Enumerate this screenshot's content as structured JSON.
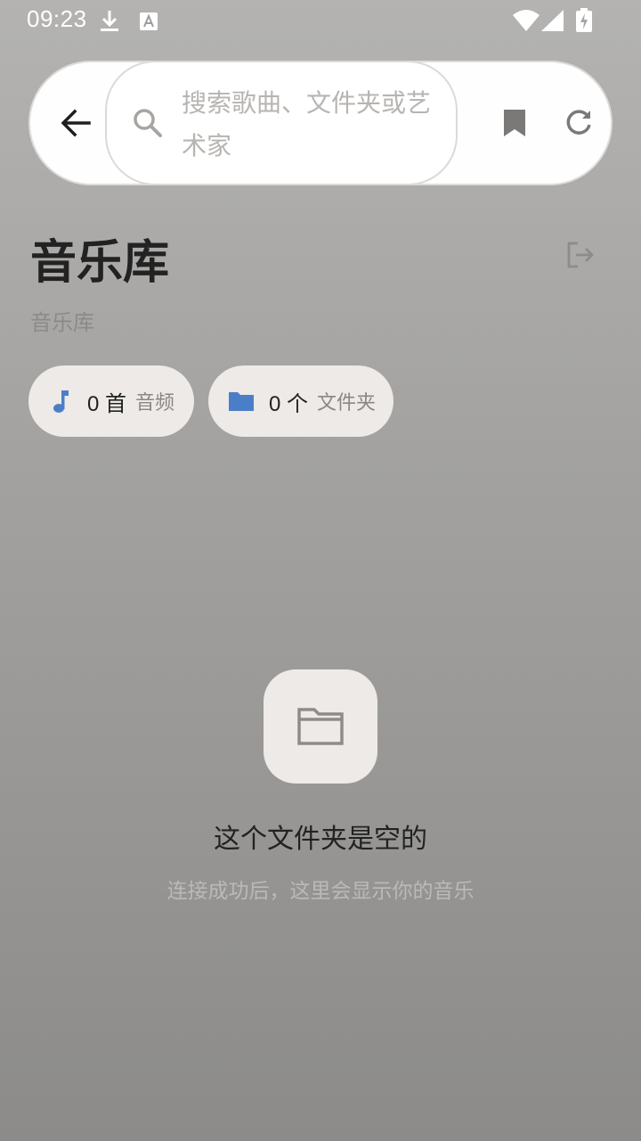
{
  "status_bar": {
    "time": "09:23",
    "icons": [
      "download-icon",
      "text-a-icon",
      "wifi-icon",
      "signal-icon",
      "battery-charging-icon"
    ]
  },
  "top_bar": {
    "back_icon": "arrow-left-icon",
    "search": {
      "placeholder": "搜索歌曲、文件夹或艺术家",
      "icon": "search-icon"
    },
    "bookmark_icon": "bookmark-icon",
    "refresh_icon": "refresh-icon"
  },
  "header": {
    "title": "音乐库",
    "subtitle": "音乐库",
    "logout_icon": "logout-icon"
  },
  "stats": {
    "audio": {
      "count": "0 首",
      "label": "音频",
      "icon": "music-note-icon"
    },
    "folders": {
      "count": "0 个",
      "label": "文件夹",
      "icon": "folder-icon"
    }
  },
  "empty_state": {
    "icon": "folder-outline-icon",
    "title": "这个文件夹是空的",
    "subtitle": "连接成功后，这里会显示你的音乐"
  },
  "colors": {
    "accent": "#4a7fc8",
    "chip_background": "#edeae7",
    "surface": "#fefefe"
  }
}
